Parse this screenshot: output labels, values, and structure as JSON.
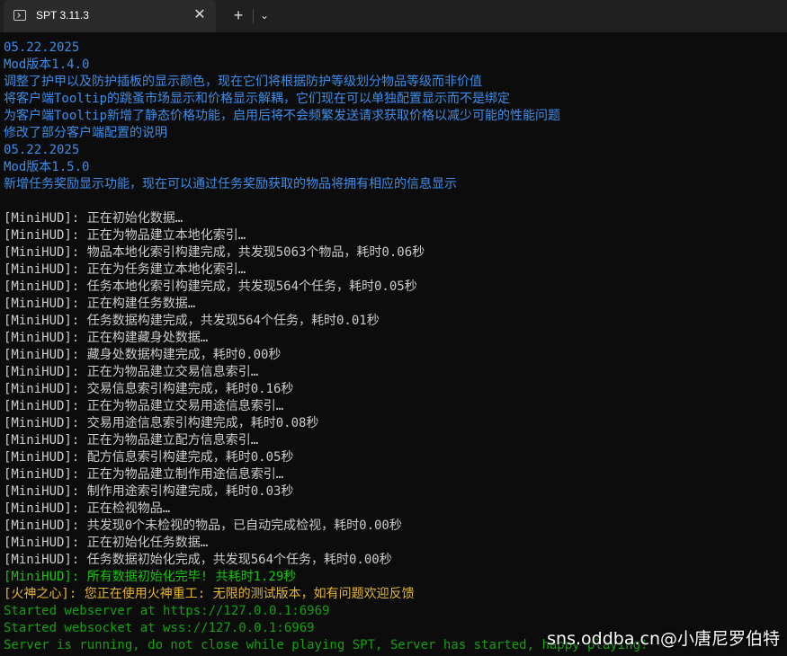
{
  "tab": {
    "icon": "terminal-icon",
    "title": "SPT 3.11.3",
    "close_glyph": "✕",
    "new_tab_glyph": "+",
    "dropdown_glyph": "⌄"
  },
  "colors": {
    "blue": "#3b8eea",
    "white": "#cccccc",
    "green": "#16c60c",
    "dark_green": "#13a10e",
    "yellow": "#e5b72e",
    "background": "#0c0c0c"
  },
  "terminal": {
    "lines": [
      {
        "text": "05.22.2025",
        "color": "blue"
      },
      {
        "text": "Mod版本1.4.0",
        "color": "blue"
      },
      {
        "text": "调整了护甲以及防护插板的显示颜色，现在它们将根据防护等级划分物品等级而非价值",
        "color": "blue"
      },
      {
        "text": "将客户端Tooltip的跳蚤市场显示和价格显示解耦，它们现在可以单独配置显示而不是绑定",
        "color": "blue"
      },
      {
        "text": "为客户端Tooltip新增了静态价格功能，启用后将不会频繁发送请求获取价格以减少可能的性能问题",
        "color": "blue"
      },
      {
        "text": "修改了部分客户端配置的说明",
        "color": "blue"
      },
      {
        "text": "05.22.2025",
        "color": "blue"
      },
      {
        "text": "Mod版本1.5.0",
        "color": "blue"
      },
      {
        "text": "新增任务奖励显示功能，现在可以通过任务奖励获取的物品将拥有相应的信息显示",
        "color": "blue"
      },
      {
        "text": "",
        "color": "white"
      },
      {
        "text": "[MiniHUD]: 正在初始化数据…",
        "color": "white"
      },
      {
        "text": "[MiniHUD]: 正在为物品建立本地化索引…",
        "color": "white"
      },
      {
        "text": "[MiniHUD]: 物品本地化索引构建完成，共发现5063个物品，耗时0.06秒",
        "color": "white"
      },
      {
        "text": "[MiniHUD]: 正在为任务建立本地化索引…",
        "color": "white"
      },
      {
        "text": "[MiniHUD]: 任务本地化索引构建完成，共发现564个任务，耗时0.05秒",
        "color": "white"
      },
      {
        "text": "[MiniHUD]: 正在构建任务数据…",
        "color": "white"
      },
      {
        "text": "[MiniHUD]: 任务数据构建完成，共发现564个任务，耗时0.01秒",
        "color": "white"
      },
      {
        "text": "[MiniHUD]: 正在构建藏身处数据…",
        "color": "white"
      },
      {
        "text": "[MiniHUD]: 藏身处数据构建完成，耗时0.00秒",
        "color": "white"
      },
      {
        "text": "[MiniHUD]: 正在为物品建立交易信息索引…",
        "color": "white"
      },
      {
        "text": "[MiniHUD]: 交易信息索引构建完成，耗时0.16秒",
        "color": "white"
      },
      {
        "text": "[MiniHUD]: 正在为物品建立交易用途信息索引…",
        "color": "white"
      },
      {
        "text": "[MiniHUD]: 交易用途信息索引构建完成，耗时0.08秒",
        "color": "white"
      },
      {
        "text": "[MiniHUD]: 正在为物品建立配方信息索引…",
        "color": "white"
      },
      {
        "text": "[MiniHUD]: 配方信息索引构建完成，耗时0.05秒",
        "color": "white"
      },
      {
        "text": "[MiniHUD]: 正在为物品建立制作用途信息索引…",
        "color": "white"
      },
      {
        "text": "[MiniHUD]: 制作用途索引构建完成，耗时0.03秒",
        "color": "white"
      },
      {
        "text": "[MiniHUD]: 正在检视物品…",
        "color": "white"
      },
      {
        "text": "[MiniHUD]: 共发现0个未检视的物品，已自动完成检视，耗时0.00秒",
        "color": "white"
      },
      {
        "text": "[MiniHUD]: 正在初始化任务数据…",
        "color": "white"
      },
      {
        "text": "[MiniHUD]: 任务数据初始化完成，共发现564个任务，耗时0.00秒",
        "color": "white"
      },
      {
        "text": "[MiniHUD]: 所有数据初始化完毕! 共耗时1.29秒",
        "color": "green"
      },
      {
        "text": "[火神之心]: 您正在使用火神重工: 无限的测试版本，如有问题欢迎反馈",
        "color": "yellow"
      },
      {
        "text": "Started webserver at https://127.0.0.1:6969",
        "color": "dark_green"
      },
      {
        "text": "Started websocket at wss://127.0.0.1:6969",
        "color": "dark_green"
      },
      {
        "text": "Server is running, do not close while playing SPT, Server has started, happy playing!",
        "color": "dark_green"
      }
    ]
  },
  "watermark": {
    "text": "sns.oddba.cn@小唐尼罗伯特"
  }
}
